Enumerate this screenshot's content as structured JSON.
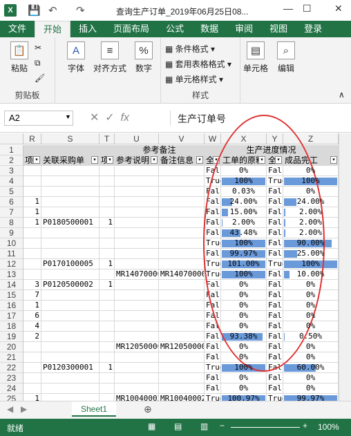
{
  "title": "查询生产订单_2019年06月25日08...",
  "tabs": [
    "文件",
    "开始",
    "插入",
    "页面布局",
    "公式",
    "数据",
    "审阅",
    "视图",
    "登录"
  ],
  "ribbon": {
    "paste": "粘贴",
    "clipboard": "剪贴板",
    "font": "字体",
    "align": "对齐方式",
    "number": "数字",
    "cond": "条件格式",
    "table": "套用表格格式",
    "cellstyle": "单元格样式",
    "styles": "样式",
    "cells": "单元格",
    "edit": "编辑"
  },
  "namebox": "A2",
  "formula": "生产订单号",
  "columns": [
    "R",
    "S",
    "T",
    "U",
    "V",
    "W",
    "X",
    "Y",
    "Z"
  ],
  "header1": {
    "u": "参考备注",
    "x": "生产进度情况"
  },
  "header2": [
    "项",
    "关联采购单",
    "项",
    "参考说明",
    "备注信息",
    "全",
    "工单的原料",
    "全",
    "成品完工"
  ],
  "rows": [
    [
      "3",
      "",
      "",
      "",
      "",
      "",
      "",
      "Fals",
      "0%",
      "Fals",
      "0%"
    ],
    [
      "4",
      "",
      "",
      "",
      "",
      "",
      "",
      "True",
      "100%",
      "True",
      "100%"
    ],
    [
      "5",
      "",
      "",
      "",
      "",
      "",
      "",
      "Fals",
      "0.03%",
      "Fals",
      "0%"
    ],
    [
      "6",
      "1",
      "",
      "",
      "",
      "",
      "",
      "Fals",
      "24.00%",
      "Fals",
      "24.00%"
    ],
    [
      "7",
      "1",
      "",
      "",
      "",
      "",
      "",
      "Fals",
      "15.00%",
      "Fals",
      "2.00%"
    ],
    [
      "8",
      "1",
      "P0180500001",
      "1",
      "",
      "",
      "",
      "Fals",
      "2.00%",
      "Fals",
      "2.00%"
    ],
    [
      "9",
      "",
      "",
      "",
      "",
      "",
      "",
      "Fals",
      "43.48%",
      "Fals",
      "2.00%"
    ],
    [
      "10",
      "",
      "",
      "",
      "",
      "",
      "",
      "True",
      "100%",
      "Fals",
      "90.00%"
    ],
    [
      "11",
      "",
      "",
      "",
      "",
      "",
      "",
      "Fals",
      "99.97%",
      "Fals",
      "25.00%"
    ],
    [
      "12",
      "",
      "P0170100005",
      "1",
      "",
      "",
      "",
      "True",
      "101.00%",
      "True",
      "100%"
    ],
    [
      "13",
      "",
      "",
      "",
      "MR14070000",
      "MR14070000",
      "",
      "True",
      "100%",
      "Fals",
      "10.00%"
    ],
    [
      "14",
      "3",
      "P0120500002",
      "1",
      "",
      "",
      "",
      "Fals",
      "0%",
      "Fals",
      "0%"
    ],
    [
      "15",
      "7",
      "",
      "",
      "",
      "",
      "",
      "Fals",
      "0%",
      "Fals",
      "0%"
    ],
    [
      "16",
      "1",
      "",
      "",
      "",
      "",
      "",
      "Fals",
      "0%",
      "Fals",
      "0%"
    ],
    [
      "17",
      "6",
      "",
      "",
      "",
      "",
      "",
      "Fals",
      "0%",
      "Fals",
      "0%"
    ],
    [
      "18",
      "4",
      "",
      "",
      "",
      "",
      "",
      "Fals",
      "0%",
      "Fals",
      "0%"
    ],
    [
      "19",
      "2",
      "",
      "",
      "",
      "",
      "",
      "Fals",
      "93.38%",
      "Fals",
      "0.50%"
    ],
    [
      "20",
      "",
      "",
      "",
      "MR12050000",
      "MR12050000",
      "",
      "Fals",
      "0%",
      "Fals",
      "0%"
    ],
    [
      "21",
      "",
      "",
      "",
      "",
      "",
      "",
      "Fals",
      "0%",
      "Fals",
      "0%"
    ],
    [
      "22",
      "",
      "P0120300001",
      "1",
      "",
      "",
      "",
      "True",
      "100%",
      "Fals",
      "60.00%"
    ],
    [
      "23",
      "",
      "",
      "",
      "",
      "",
      "",
      "Fals",
      "0%",
      "Fals",
      "0%"
    ],
    [
      "24",
      "",
      "",
      "",
      "",
      "",
      "",
      "Fals",
      "0%",
      "Fals",
      "0%"
    ],
    [
      "25",
      "1",
      "",
      "",
      "MR10040002",
      "MR10040002",
      "",
      "True",
      "100.97%",
      "True",
      "99.97%"
    ]
  ],
  "barfrac": [
    [
      0,
      0
    ],
    [
      1,
      1
    ],
    [
      0,
      0
    ],
    [
      0.24,
      0.24
    ],
    [
      0.15,
      0.02
    ],
    [
      0.02,
      0.02
    ],
    [
      0.43,
      0.02
    ],
    [
      1,
      0.9
    ],
    [
      1,
      0.25
    ],
    [
      1,
      1
    ],
    [
      1,
      0.1
    ],
    [
      0,
      0
    ],
    [
      0,
      0
    ],
    [
      0,
      0
    ],
    [
      0,
      0
    ],
    [
      0,
      0
    ],
    [
      0.93,
      0.005
    ],
    [
      0,
      0
    ],
    [
      0,
      0
    ],
    [
      1,
      0.6
    ],
    [
      0,
      0
    ],
    [
      0,
      0
    ],
    [
      1,
      1
    ]
  ],
  "sheet": "Sheet1",
  "status": "就绪",
  "zoom": "100%"
}
